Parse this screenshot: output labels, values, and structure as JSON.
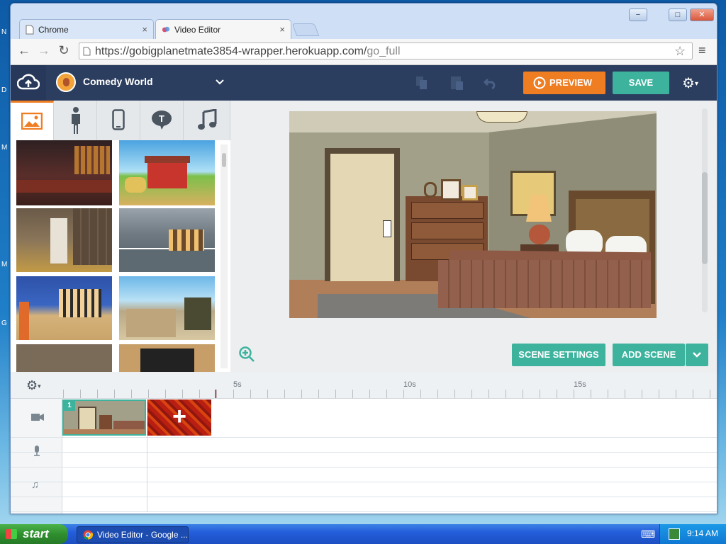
{
  "desktop": {
    "edge_letters": [
      "N",
      "D",
      "M",
      "M",
      "G"
    ]
  },
  "window": {
    "buttons": {
      "minimize": "−",
      "maximize": "□",
      "close": "✕"
    },
    "tabs": [
      {
        "label": "Chrome",
        "close": "×"
      },
      {
        "label": "Video Editor",
        "close": "×"
      }
    ],
    "url": {
      "base": "https://gobigplanetmate3854-wrapper.herokuapp.com/",
      "path": "go_full"
    }
  },
  "app": {
    "project": {
      "title": "Comedy World"
    },
    "toolbar": {
      "preview_label": "PREVIEW",
      "save_label": "SAVE"
    },
    "stage_buttons": {
      "scene_settings": "SCENE SETTINGS",
      "add_scene": "ADD SCENE"
    },
    "timeline": {
      "ticks": [
        "5s",
        "10s",
        "15s"
      ],
      "scene_number": "1",
      "add_glyph": "+"
    }
  },
  "colors": {
    "accent_orange": "#ef7d22",
    "accent_teal": "#3db39e",
    "topbar": "#2c3e5f"
  },
  "taskbar": {
    "start_label": "start",
    "task_label": "Video Editor - Google ...",
    "clock": "9:14 AM"
  }
}
